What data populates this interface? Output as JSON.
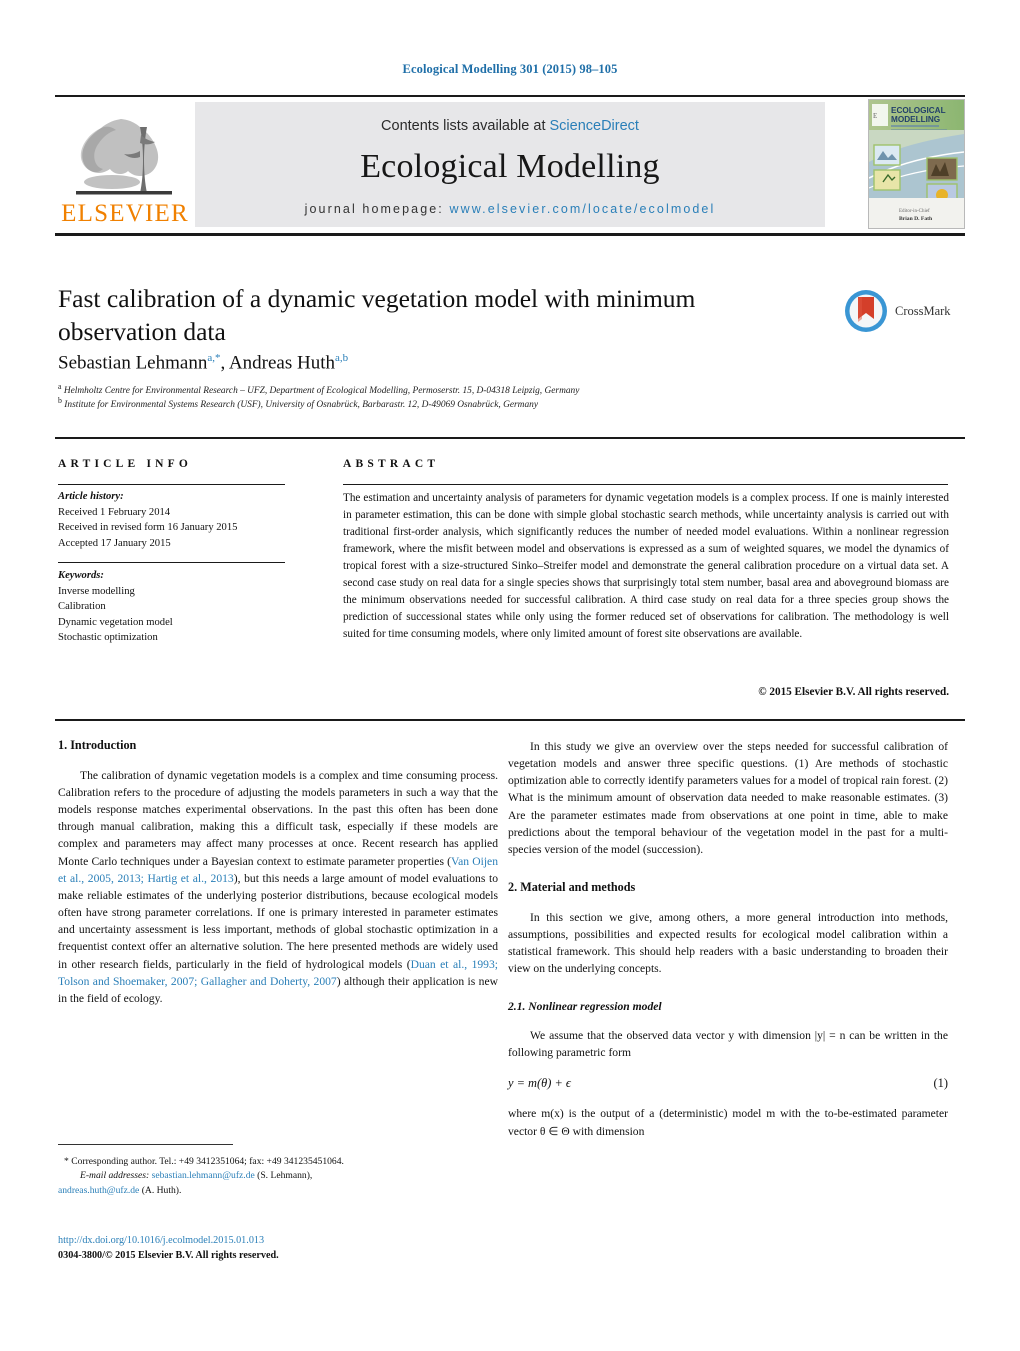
{
  "running_head": "Ecological Modelling 301 (2015) 98–105",
  "masthead": {
    "publisher_name": "ELSEVIER",
    "contents_prefix": "Contents lists available at ",
    "contents_link": "ScienceDirect",
    "journal_name": "Ecological Modelling",
    "homepage_prefix": "journal homepage: ",
    "homepage_url": "www.elsevier.com/locate/ecolmodel",
    "cover_title_line1": "ECOLOGICAL",
    "cover_title_line2": "MODELLING"
  },
  "article": {
    "title": "Fast calibration of a dynamic vegetation model with minimum observation data",
    "authors_1": "Sebastian Lehmann",
    "authors_1_sup": "a,*",
    "authors_sep": ", ",
    "authors_2": "Andreas Huth",
    "authors_2_sup": "a,b",
    "affiliation_a_sup": "a",
    "affiliation_a": "Helmholtz Centre for Environmental Research – UFZ, Department of Ecological Modelling, Permoserstr. 15, D-04318 Leipzig, Germany",
    "affiliation_b_sup": "b",
    "affiliation_b": "Institute for Environmental Systems Research (USF), University of Osnabrück, Barbarastr. 12, D-49069 Osnabrück, Germany",
    "crossmark_label": "CrossMark"
  },
  "info": {
    "heading": "ARTICLE INFO",
    "history_label": "Article history:",
    "history": [
      "Received 1 February 2014",
      "Received in revised form 16 January 2015",
      "Accepted 17 January 2015"
    ],
    "keywords_label": "Keywords:",
    "keywords": [
      "Inverse modelling",
      "Calibration",
      "Dynamic vegetation model",
      "Stochastic optimization"
    ]
  },
  "abstract": {
    "heading": "ABSTRACT",
    "text": "The estimation and uncertainty analysis of parameters for dynamic vegetation models is a complex process. If one is mainly interested in parameter estimation, this can be done with simple global stochastic search methods, while uncertainty analysis is carried out with traditional first-order analysis, which significantly reduces the number of needed model evaluations. Within a nonlinear regression framework, where the misfit between model and observations is expressed as a sum of weighted squares, we model the dynamics of tropical forest with a size-structured Sinko–Streifer model and demonstrate the general calibration procedure on a virtual data set. A second case study on real data for a single species shows that surprisingly total stem number, basal area and aboveground biomass are the minimum observations needed for successful calibration. A third case study on real data for a three species group shows the prediction of successional states while only using the former reduced set of observations for calibration. The methodology is well suited for time consuming models, where only limited amount of forest site observations are available.",
    "copyright": "© 2015 Elsevier B.V. All rights reserved."
  },
  "body": {
    "section1_heading": "1.  Introduction",
    "intro_p1_a": "The calibration of dynamic vegetation models is a complex and time consuming process. Calibration refers to the procedure of adjusting the models parameters in such a way that the models response matches experimental observations. In the past this often has been done through manual calibration, making this a difficult task, especially if these models are complex and parameters may affect many processes at once. Recent research has applied Monte Carlo techniques under a Bayesian context to estimate parameter properties (",
    "intro_p1_ref1": "Van Oijen et al., 2005, 2013; Hartig et al., 2013",
    "intro_p1_b": "), but this needs a large amount of model evaluations to make reliable estimates of the underlying posterior distributions, because ecological models often have strong parameter correlations. If one is primary interested in parameter estimates and uncertainty assessment is less important, methods of global stochastic optimization in a frequentist context offer an alternative solution. The here presented methods are widely used in other research fields, particularly in the field of hydrological models (",
    "intro_p1_ref2": "Duan et al., 1993; Tolson and Shoemaker, 2007; Gallagher and Doherty, 2007",
    "intro_p1_c": ") although their application is new in the field of ecology.",
    "intro_p2": "In this study we give an overview over the steps needed for successful calibration of vegetation models and answer three specific questions. (1) Are methods of stochastic optimization able to correctly identify parameters values for a model of tropical rain forest. (2) What is the minimum amount of observation data needed to make reasonable estimates. (3) Are the parameter estimates made from observations at one point in time, able to make predictions about the temporal behaviour of the vegetation model in the past for a multi-species version of the model (succession).",
    "section2_heading": "2.  Material and methods",
    "methods_p1": "In this section we give, among others, a more general introduction into methods, assumptions, possibilities and expected results for ecological model calibration within a statistical framework. This should help readers with a basic understanding to broaden their view on the underlying concepts.",
    "subsection21_heading": "2.1.  Nonlinear regression model",
    "methods_p2": "We assume that the observed data vector y with dimension |y| = n can be written in the following parametric form",
    "equation1": "y = m(θ) + ϵ",
    "equation1_number": "(1)",
    "methods_p3": "where m(x) is the output of a (deterministic) model m with the to-be-estimated parameter vector θ ∈ Θ with dimension"
  },
  "footnotes": {
    "star": "*",
    "corresponding": "Corresponding author. Tel.: +49 3412351064; fax: +49 341235451064.",
    "email_label": "E-mail addresses:",
    "email1": "sebastian.lehmann@ufz.de",
    "email1_owner": "(S. Lehmann),",
    "email2": "andreas.huth@ufz.de",
    "email2_owner": "(A. Huth).",
    "doi": "http://dx.doi.org/10.1016/j.ecolmodel.2015.01.013",
    "issn_line": "0304-3800/© 2015 Elsevier B.V. All rights reserved."
  },
  "colors": {
    "link": "#2a7fb8",
    "elsevier_orange": "#f08000",
    "band_gray": "#e7e7e9"
  }
}
